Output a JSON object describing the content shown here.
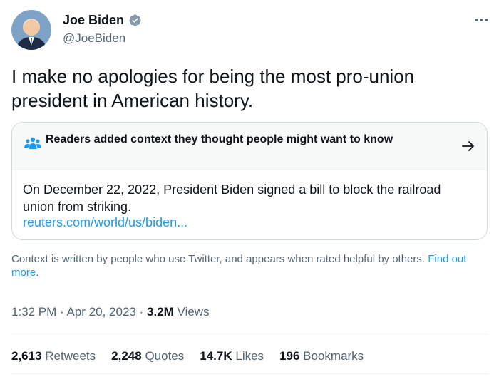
{
  "author": {
    "name": "Joe Biden",
    "handle": "@JoeBiden",
    "verified": true,
    "avatar_icon": "avatar-portrait",
    "verified_icon": "verified-badge-icon"
  },
  "tweet": {
    "text": "I make no apologies for being the most pro-union president in American history."
  },
  "context_note": {
    "title": "Readers added context they thought people might want to know",
    "body": "On December 22, 2022, President Biden signed a bill to block the railroad union from striking.",
    "link": "reuters.com/world/us/biden..."
  },
  "footnote": {
    "text": "Context is written by people who use Twitter, and appears when rated helpful by others. ",
    "link": "Find out more",
    "end": "."
  },
  "meta": {
    "time": "1:32 PM",
    "separator": "·",
    "date": "Apr 20, 2023",
    "views_count": "3.2M",
    "views_label": "Views"
  },
  "stats": [
    {
      "count": "2,613",
      "label": "Retweets"
    },
    {
      "count": "2,248",
      "label": "Quotes"
    },
    {
      "count": "14.7K",
      "label": "Likes"
    },
    {
      "count": "196",
      "label": "Bookmarks"
    }
  ],
  "colors": {
    "text": "#0f1419",
    "secondary": "#536471",
    "link": "#1d9bf0",
    "border": "#cfd9de",
    "context_header_bg": "#f7f9f9"
  }
}
